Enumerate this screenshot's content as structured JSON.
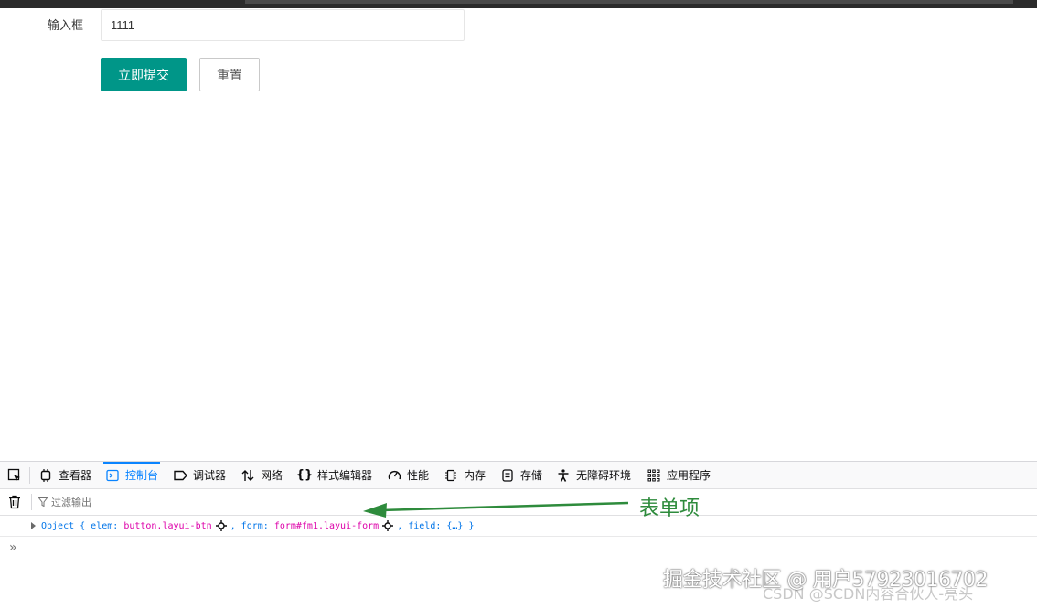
{
  "form": {
    "input_label": "输入框",
    "input_value": "1111",
    "submit_label": "立即提交",
    "reset_label": "重置"
  },
  "devtools": {
    "tabs": [
      {
        "label": "查看器",
        "icon": "inspector-icon"
      },
      {
        "label": "控制台",
        "icon": "console-icon",
        "active": true
      },
      {
        "label": "调试器",
        "icon": "debugger-icon"
      },
      {
        "label": "网络",
        "icon": "network-icon"
      },
      {
        "label": "样式编辑器",
        "icon": "style-editor-icon"
      },
      {
        "label": "性能",
        "icon": "performance-icon"
      },
      {
        "label": "内存",
        "icon": "memory-icon"
      },
      {
        "label": "存储",
        "icon": "storage-icon"
      },
      {
        "label": "无障碍环境",
        "icon": "accessibility-icon"
      },
      {
        "label": "应用程序",
        "icon": "application-icon"
      }
    ],
    "filter_placeholder": "过滤输出",
    "log": {
      "prefix": "Object { elem: ",
      "elem_value": "button.layui-btn",
      "mid1": ", form: ",
      "form_value": "form#fm1.layui-form",
      "mid2": ", field: ",
      "field_value": "{…}",
      "suffix": " }"
    },
    "prompt": "»"
  },
  "annotation": {
    "text": "表单项",
    "color": "#2e8b3c"
  },
  "watermarks": {
    "primary": "掘金技术社区 @ 用户57923016702",
    "secondary": "CSDN @SCDN内容合伙人-亮头"
  },
  "colors": {
    "primary_button": "#009688",
    "devtools_accent": "#0a84ff"
  }
}
